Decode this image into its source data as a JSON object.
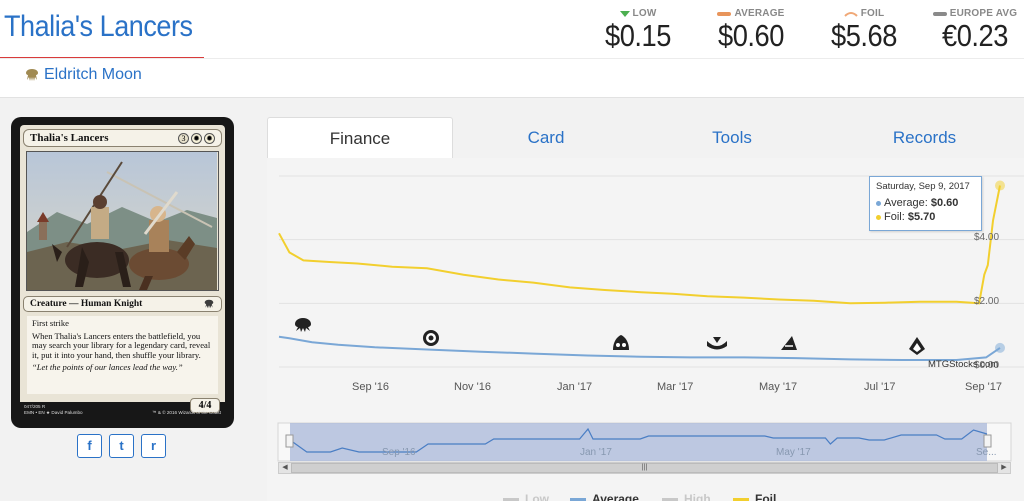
{
  "card": {
    "title": "Thalia's Lancers",
    "set_name": "Eldritch Moon",
    "name_line": "Thalia's Lancers",
    "mana_cost": [
      "3",
      "W",
      "W"
    ],
    "type_line": "Creature — Human Knight",
    "rules_1": "First strike",
    "rules_2": "When Thalia's Lancers enters the battlefield, you may search your library for a legendary card, reveal it, put it into your hand, then shuffle your library.",
    "flavor": "“Let the points of our lances lead the way.”",
    "pt": "4/4",
    "collector": "047/205 R",
    "set_line": "EMN • EN ★ David Palumbo",
    "copyright": "™ & © 2016 Wizards of the Coast"
  },
  "prices": [
    {
      "label": "LOW",
      "value": "$0.15",
      "color": "#4caf50"
    },
    {
      "label": "AVERAGE",
      "value": "$0.60",
      "color": "#e8955b"
    },
    {
      "label": "FOIL",
      "value": "$5.68",
      "color": "#f0a877"
    },
    {
      "label": "EUROPE AVG",
      "value": "€0.23",
      "color": "#8a8a8a"
    }
  ],
  "share": [
    "f",
    "t",
    "r"
  ],
  "tabs": [
    {
      "label": "Finance",
      "active": true
    },
    {
      "label": "Card",
      "active": false
    },
    {
      "label": "Tools",
      "active": false
    },
    {
      "label": "Records",
      "active": false
    }
  ],
  "tooltip": {
    "date": "Saturday, Sep 9, 2017",
    "average_label": "Average:",
    "average_value": "$0.60",
    "foil_label": "Foil:",
    "foil_value": "$5.70"
  },
  "credit": "MTGStocks.com",
  "navigator_labels": [
    "Sep '16",
    "Jan '17",
    "May '17",
    "Se..."
  ],
  "legend": [
    {
      "label": "Low",
      "color": "#c8c8c8"
    },
    {
      "label": "Average",
      "color": "#7aa7d6"
    },
    {
      "label": "High",
      "color": "#c8c8c8"
    },
    {
      "label": "Foil",
      "color": "#f2cf2e"
    }
  ],
  "chart_data": {
    "type": "line",
    "x_labels": [
      "Sep '16",
      "Nov '16",
      "Jan '17",
      "Mar '17",
      "May '17",
      "Jul '17",
      "Sep '17"
    ],
    "y_ticks": [
      "$4.00",
      "$2.00",
      "$0.00"
    ],
    "ylim": [
      0,
      6
    ],
    "x_range": [
      "2016-07-22",
      "2017-09-09"
    ],
    "series": [
      {
        "name": "Foil",
        "color": "#f2cf2e",
        "points": [
          [
            "2016-07-22",
            4.2
          ],
          [
            "2016-07-24",
            4.0
          ],
          [
            "2016-07-28",
            3.6
          ],
          [
            "2016-08-05",
            3.35
          ],
          [
            "2016-08-20",
            3.3
          ],
          [
            "2016-09-05",
            3.25
          ],
          [
            "2016-09-25",
            3.15
          ],
          [
            "2016-10-15",
            3.1
          ],
          [
            "2016-11-05",
            2.9
          ],
          [
            "2016-11-25",
            2.75
          ],
          [
            "2016-12-15",
            2.65
          ],
          [
            "2017-01-05",
            2.5
          ],
          [
            "2017-01-25",
            2.42
          ],
          [
            "2017-02-15",
            2.35
          ],
          [
            "2017-03-05",
            2.3
          ],
          [
            "2017-03-25",
            2.22
          ],
          [
            "2017-04-15",
            2.18
          ],
          [
            "2017-05-05",
            2.12
          ],
          [
            "2017-05-25",
            2.08
          ],
          [
            "2017-06-15",
            2.0
          ],
          [
            "2017-07-05",
            2.02
          ],
          [
            "2017-07-25",
            2.05
          ],
          [
            "2017-08-15",
            2.05
          ],
          [
            "2017-08-28",
            2.0
          ],
          [
            "2017-08-31",
            2.9
          ],
          [
            "2017-09-02",
            3.2
          ],
          [
            "2017-09-05",
            4.6
          ],
          [
            "2017-09-09",
            5.7
          ]
        ]
      },
      {
        "name": "Average",
        "color": "#7aa7d6",
        "points": [
          [
            "2016-07-22",
            0.95
          ],
          [
            "2016-07-28",
            0.9
          ],
          [
            "2016-08-10",
            0.78
          ],
          [
            "2016-08-25",
            0.7
          ],
          [
            "2016-09-15",
            0.62
          ],
          [
            "2016-10-15",
            0.55
          ],
          [
            "2016-11-15",
            0.48
          ],
          [
            "2016-12-15",
            0.42
          ],
          [
            "2017-01-15",
            0.36
          ],
          [
            "2017-02-15",
            0.32
          ],
          [
            "2017-03-15",
            0.3
          ],
          [
            "2017-04-15",
            0.3
          ],
          [
            "2017-05-15",
            0.28
          ],
          [
            "2017-06-15",
            0.24
          ],
          [
            "2017-07-15",
            0.22
          ],
          [
            "2017-08-15",
            0.22
          ],
          [
            "2017-09-01",
            0.3
          ],
          [
            "2017-09-09",
            0.6
          ]
        ]
      }
    ],
    "set_markers": [
      {
        "name": "emn-set-icon",
        "date": "2016-07-22"
      },
      {
        "name": "kld-set-icon",
        "date": "2016-09-30"
      },
      {
        "name": "aer-set-icon",
        "date": "2017-01-20"
      },
      {
        "name": "akh-set-icon",
        "date": "2017-04-28"
      },
      {
        "name": "hou-set-icon",
        "date": "2017-05-25"
      },
      {
        "name": "xln-set-icon",
        "date": "2017-07-14"
      }
    ]
  },
  "navigator_series": [
    [
      "2016-07-22",
      0.9
    ],
    [
      "2016-08-01",
      0.3
    ],
    [
      "2016-08-15",
      0.3
    ],
    [
      "2016-08-22",
      0.5
    ],
    [
      "2016-09-01",
      0.3
    ],
    [
      "2016-10-05",
      0.3
    ],
    [
      "2016-10-12",
      0.7
    ],
    [
      "2016-11-15",
      0.7
    ],
    [
      "2016-11-20",
      0.95
    ],
    [
      "2017-01-10",
      0.95
    ],
    [
      "2017-01-15",
      1.45
    ],
    [
      "2017-01-18",
      0.95
    ],
    [
      "2017-02-15",
      0.95
    ],
    [
      "2017-02-20",
      1.1
    ],
    [
      "2017-04-30",
      1.1
    ],
    [
      "2017-05-05",
      1.0
    ],
    [
      "2017-06-05",
      1.0
    ],
    [
      "2017-06-08",
      0.7
    ],
    [
      "2017-06-12",
      1.0
    ],
    [
      "2017-06-25",
      1.0
    ],
    [
      "2017-07-01",
      0.9
    ],
    [
      "2017-07-10",
      0.9
    ],
    [
      "2017-07-20",
      1.15
    ],
    [
      "2017-08-10",
      1.15
    ],
    [
      "2017-08-15",
      0.95
    ],
    [
      "2017-08-25",
      0.95
    ],
    [
      "2017-09-01",
      1.4
    ],
    [
      "2017-09-09",
      1.2
    ]
  ]
}
